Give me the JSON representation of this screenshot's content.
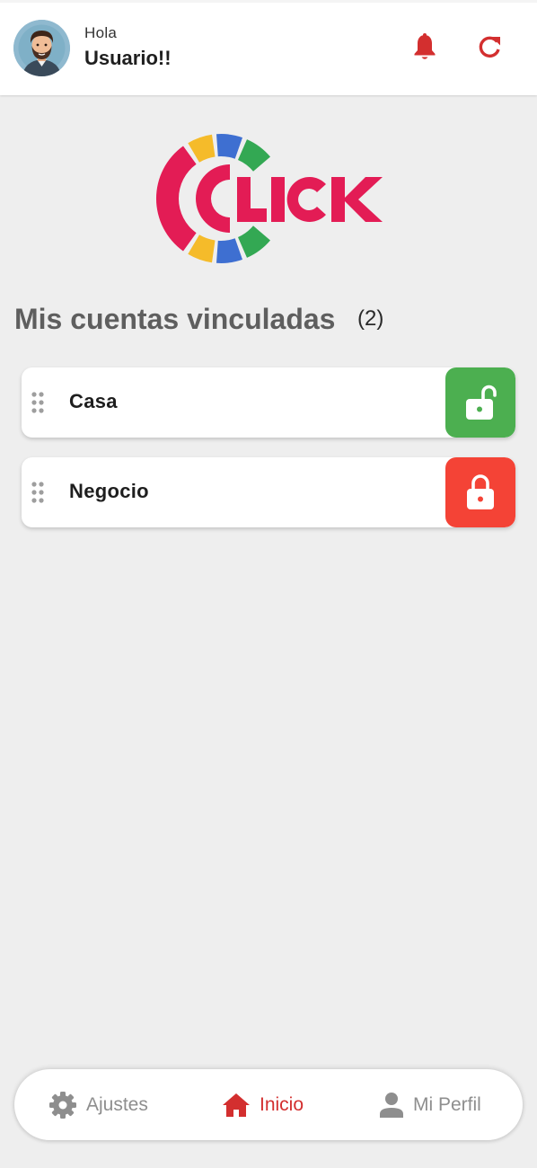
{
  "header": {
    "greeting": "Hola",
    "username": "Usuario!!",
    "avatar_icon": "user-avatar-icon",
    "notification_icon": "bell-icon",
    "refresh_icon": "refresh-icon",
    "accent_color": "#d32f2f"
  },
  "logo": {
    "text": "CLICK",
    "brand_color": "#e31c55"
  },
  "accounts": {
    "title": "Mis cuentas vinculadas",
    "count": "(2)",
    "items": [
      {
        "label": "Casa",
        "status": "unlocked",
        "icon": "unlock-icon",
        "color": "#4caf50"
      },
      {
        "label": "Negocio",
        "status": "locked",
        "icon": "lock-icon",
        "color": "#f44336"
      }
    ]
  },
  "nav": {
    "items": [
      {
        "label": "Ajustes",
        "icon": "gear-icon",
        "active": false
      },
      {
        "label": "Inicio",
        "icon": "home-icon",
        "active": true
      },
      {
        "label": "Mi Perfil",
        "icon": "person-icon",
        "active": false
      }
    ],
    "active_color": "#d32f2f",
    "inactive_color": "#8e8e8e"
  }
}
